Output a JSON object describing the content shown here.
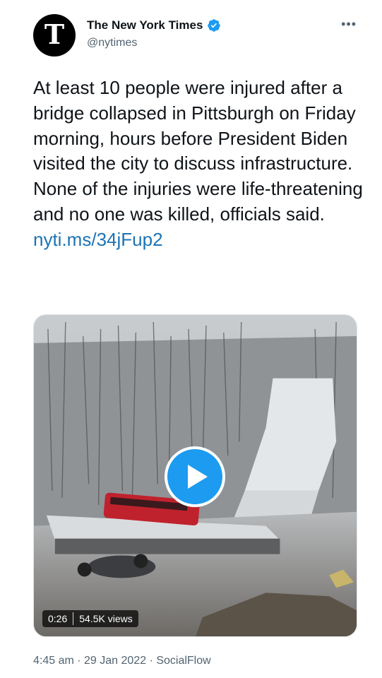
{
  "account": {
    "display_name": "The New York Times",
    "handle": "@nytimes",
    "avatar_glyph": "T",
    "verified_icon": "verified-badge-icon",
    "more_label": "•••"
  },
  "tweet": {
    "text": "At least 10 people were injured after a bridge collapsed in Pittsburgh on Friday morning, hours before President Biden visited the city to discuss infrastructure. None of the injuries were life-threatening and no one was killed, officials said.",
    "link": "nyti.ms/34jFup2"
  },
  "media": {
    "type": "video",
    "duration": "0:26",
    "views": "54.5K views",
    "play_icon": "play-icon"
  },
  "meta": {
    "time": "4:45 am",
    "date": "29 Jan 2022",
    "source": "SocialFlow",
    "separator": " · "
  },
  "colors": {
    "accent": "#1d9bf0",
    "link": "#1d73b4",
    "secondary_text": "#536471"
  }
}
